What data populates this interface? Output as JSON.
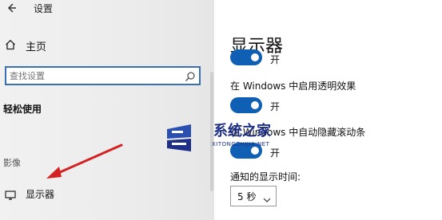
{
  "sidebar": {
    "app_title": "设置",
    "home_label": "主页",
    "search_placeholder": "查找设置",
    "section_title": "轻松使用",
    "group_title": "影像",
    "display_label": "显示器"
  },
  "main": {
    "page_title": "显示器",
    "toggle_on_label": "开",
    "transparency_label": "在 Windows 中启用透明效果",
    "autohide_scrollbar_label": "在 Windows 中自动隐藏滚动条",
    "notification_time_label": "通知的显示时间:",
    "notification_time_value": "5 秒"
  },
  "watermark": {
    "title": "系统之家",
    "subtitle": "XITONGZHIJIA.NET"
  },
  "colors": {
    "accent": "#0f5fb5",
    "search_border": "#3a6fb3",
    "annotation_arrow": "#d42222",
    "watermark": "#1d2f86"
  }
}
